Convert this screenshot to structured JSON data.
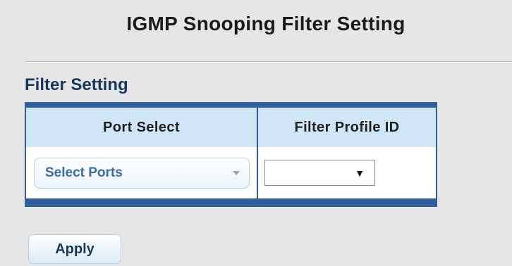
{
  "page": {
    "title": "IGMP Snooping Filter Setting"
  },
  "filter_setting": {
    "heading": "Filter Setting",
    "columns": [
      "Port Select",
      "Filter Profile ID"
    ],
    "port_select": {
      "value": "Select Ports"
    },
    "filter_profile": {
      "value": ""
    }
  },
  "actions": {
    "apply_label": "Apply"
  },
  "colors": {
    "background": "#e6e6e6",
    "table_frame": "#2f5f9f",
    "header_bg": "#cfe6f6",
    "heading_text": "#17375e"
  },
  "icons": {
    "port_select_caret": "caret-down-icon",
    "profile_select_caret": "caret-down-icon"
  }
}
